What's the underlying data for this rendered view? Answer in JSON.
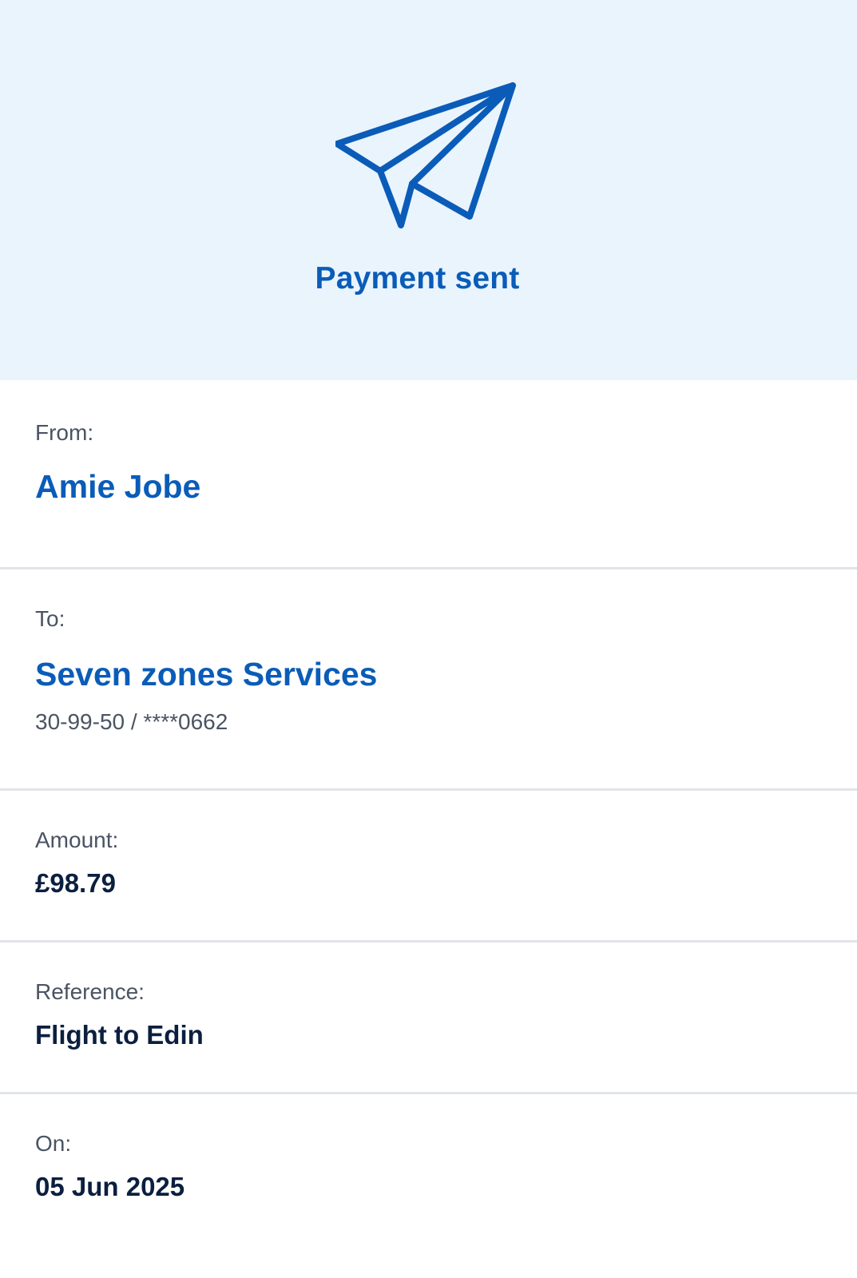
{
  "header": {
    "title": "Payment sent",
    "icon": "paper-plane-icon",
    "accent_color": "#0a5cb8",
    "background_color": "#eaf4fd"
  },
  "from": {
    "label": "From:",
    "name": "Amie Jobe"
  },
  "to": {
    "label": "To:",
    "name": "Seven zones Services",
    "account": "30-99-50 / ****0662"
  },
  "amount": {
    "label": "Amount:",
    "value": "£98.79"
  },
  "reference": {
    "label": "Reference:",
    "value": "Flight to Edin"
  },
  "date": {
    "label": "On:",
    "value": "05 Jun 2025"
  }
}
